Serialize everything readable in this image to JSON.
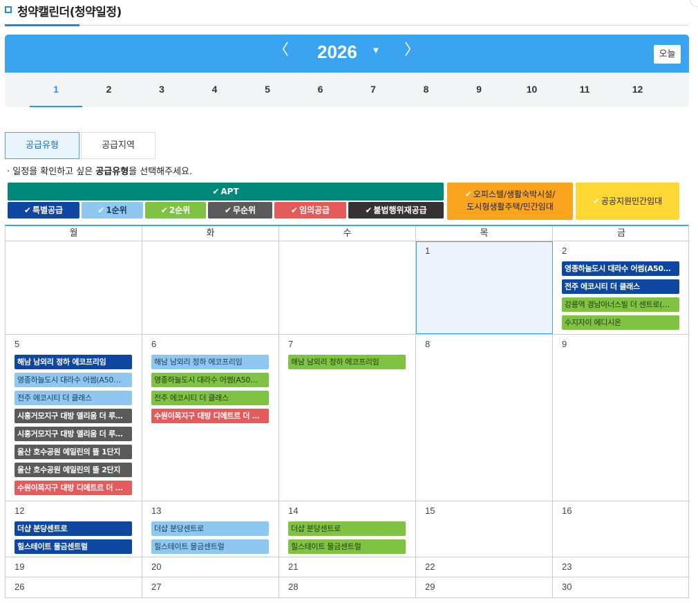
{
  "title": "청약캘린더(청약일정)",
  "year": "2026",
  "prev_arrow": "〈",
  "next_arrow": "〉",
  "caret": "▼",
  "today_button": "오늘",
  "months": [
    "1",
    "2",
    "3",
    "4",
    "5",
    "6",
    "7",
    "8",
    "9",
    "10",
    "11",
    "12"
  ],
  "active_month_index": 0,
  "tabs": [
    "공급유형",
    "공급지역"
  ],
  "notice": {
    "prefix": "· 일정을 확인하고 싶은 ",
    "bold": "공급유형",
    "suffix": "을 선택해주세요."
  },
  "filters": {
    "check": "✔",
    "apt": "APT",
    "special": "특별공급",
    "first": "1순위",
    "second": "2순위",
    "none": "무순위",
    "random": "임의공급",
    "illegal": "불법행위재공급",
    "officetel_line1": "오피스텔/생활숙박시설/",
    "officetel_line2": "도시형생활주택/민간임대",
    "public": "공공지원민간임대"
  },
  "colors": {
    "apt": "#00897b",
    "special": "#0d47a1",
    "first": "#8ec8f1",
    "second": "#80c342",
    "none": "#5a5a5a",
    "random": "#e55b5b",
    "illegal": "#333333",
    "officetel": "#fba41e",
    "public": "#fdd835"
  },
  "weekdays": [
    "월",
    "화",
    "수",
    "목",
    "금"
  ],
  "weeks": [
    [
      {
        "day": "",
        "events": []
      },
      {
        "day": "",
        "events": []
      },
      {
        "day": "",
        "events": []
      },
      {
        "day": "1",
        "today": true,
        "events": []
      },
      {
        "day": "2",
        "events": [
          {
            "type": "special",
            "label": "영종하늘도시 대라수 어썸(A50…"
          },
          {
            "type": "special",
            "label": "전주 에코시티 더 클래스"
          },
          {
            "type": "second",
            "label": "강릉역 경남아너스빌 더 센트로(…"
          },
          {
            "type": "second",
            "label": "수지자이 에디시온"
          }
        ]
      }
    ],
    [
      {
        "day": "5",
        "events": [
          {
            "type": "special",
            "label": "해남 남외리 정하 에코프리임"
          },
          {
            "type": "first",
            "label": "영종하늘도시 대라수 어썸(A50…"
          },
          {
            "type": "first",
            "label": "전주 에코시티 더 클래스"
          },
          {
            "type": "none",
            "label": "시흥거모지구 대방 엘리움 더 루…"
          },
          {
            "type": "none",
            "label": "시흥거모지구 대방 엘리움 더 루…"
          },
          {
            "type": "none",
            "label": "울산 호수공원 예일린의 뜰 1단지"
          },
          {
            "type": "none",
            "label": "울산 호수공원 예일린의 뜰 2단지"
          },
          {
            "type": "random",
            "label": "수원이목지구 대방 디에트르 더 …"
          }
        ]
      },
      {
        "day": "6",
        "events": [
          {
            "type": "first",
            "label": "해남 남외리 정하 에코프리임"
          },
          {
            "type": "second",
            "label": "영종하늘도시 대라수 어썸(A50…"
          },
          {
            "type": "second",
            "label": "전주 에코시티 더 클래스"
          },
          {
            "type": "random",
            "label": "수원이목지구 대방 디에트르 더 …"
          }
        ]
      },
      {
        "day": "7",
        "events": [
          {
            "type": "second",
            "label": "해남 남외리 정하 에코프리임"
          }
        ]
      },
      {
        "day": "8",
        "events": []
      },
      {
        "day": "9",
        "events": []
      }
    ],
    [
      {
        "day": "12",
        "events": [
          {
            "type": "special",
            "label": "더샵 분당센트로"
          },
          {
            "type": "special",
            "label": "힐스테이트 물금센트럴"
          }
        ]
      },
      {
        "day": "13",
        "events": [
          {
            "type": "first",
            "label": "더샵 분당센트로"
          },
          {
            "type": "first",
            "label": "힐스테이트 물금센트럴"
          }
        ]
      },
      {
        "day": "14",
        "events": [
          {
            "type": "second",
            "label": "더샵 분당센트로"
          },
          {
            "type": "second",
            "label": "힐스테이트 물금센트럴"
          }
        ]
      },
      {
        "day": "15",
        "events": []
      },
      {
        "day": "16",
        "events": []
      }
    ],
    [
      {
        "day": "19",
        "events": []
      },
      {
        "day": "20",
        "events": []
      },
      {
        "day": "21",
        "events": []
      },
      {
        "day": "22",
        "events": []
      },
      {
        "day": "23",
        "events": []
      }
    ],
    [
      {
        "day": "26",
        "events": []
      },
      {
        "day": "27",
        "events": []
      },
      {
        "day": "28",
        "events": []
      },
      {
        "day": "29",
        "events": []
      },
      {
        "day": "30",
        "events": []
      }
    ]
  ]
}
